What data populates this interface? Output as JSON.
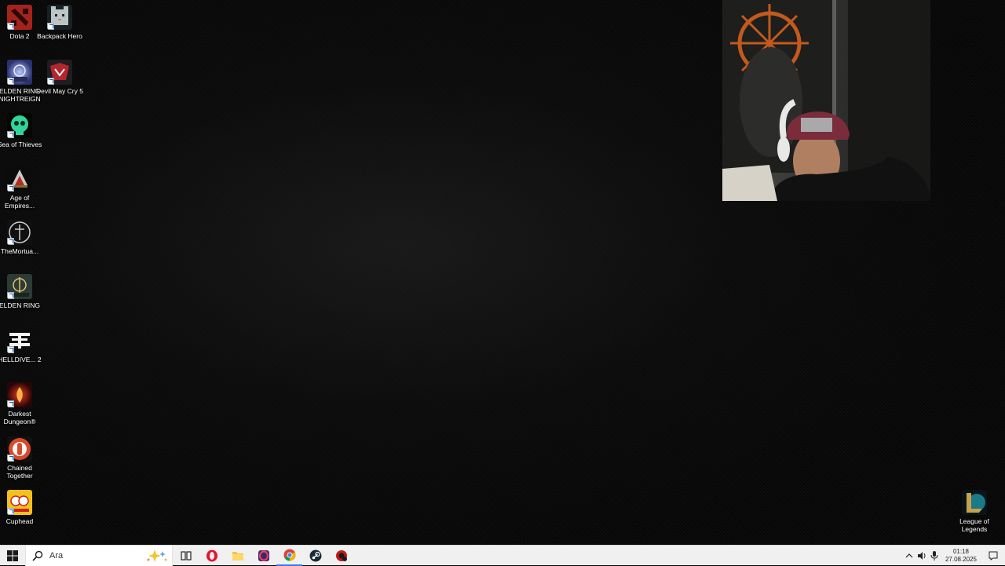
{
  "desktop": {
    "icons": [
      {
        "label": "Dota 2",
        "icon": "dota2-icon"
      },
      {
        "label": "Backpack Hero",
        "icon": "backpack-hero-icon"
      },
      {
        "label": "ELDEN RING NIGHTREIGN",
        "icon": "elden-ring-nightreign-icon"
      },
      {
        "label": "Devil May Cry 5",
        "icon": "devil-may-cry-5-icon"
      },
      {
        "label": "Sea of Thieves",
        "icon": "sea-of-thieves-icon"
      },
      {
        "label": "Age of Empires...",
        "icon": "age-of-empires-icon"
      },
      {
        "label": "TheMortua...",
        "icon": "the-mortuary-icon"
      },
      {
        "label": "ELDEN RING",
        "icon": "elden-ring-icon"
      },
      {
        "label": "HELLDIVE... 2",
        "icon": "helldivers-2-icon"
      },
      {
        "label": "Darkest Dungeon®",
        "icon": "darkest-dungeon-icon"
      },
      {
        "label": "Chained Together",
        "icon": "chained-together-icon"
      },
      {
        "label": "Cuphead",
        "icon": "cuphead-icon"
      },
      {
        "label": "League of Legends",
        "icon": "league-of-legends-icon"
      }
    ]
  },
  "taskbar": {
    "search_placeholder": "Ara",
    "apps": [
      {
        "name": "task-view",
        "icon": "task-view-icon"
      },
      {
        "name": "opera",
        "icon": "opera-icon"
      },
      {
        "name": "file-explorer",
        "icon": "folder-icon"
      },
      {
        "name": "opera-gx",
        "icon": "opera-gx-icon"
      },
      {
        "name": "chrome",
        "icon": "chrome-icon"
      },
      {
        "name": "steam",
        "icon": "steam-icon"
      },
      {
        "name": "game-app",
        "icon": "game-app-icon"
      }
    ],
    "clock": {
      "time": "01:18",
      "date": "27.08.2025"
    }
  },
  "colors": {
    "taskbar_bg": "#f0f0f0",
    "desktop_bg": "#060606",
    "label_text": "#ffffff"
  }
}
